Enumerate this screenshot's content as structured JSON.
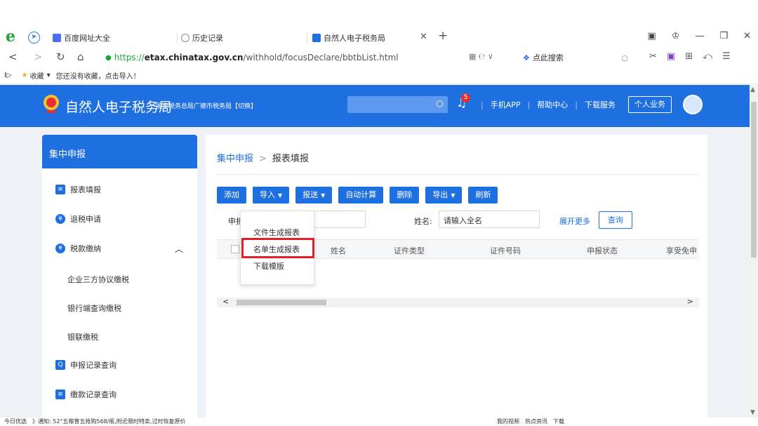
{
  "browser": {
    "tabs": [
      {
        "label": "百度网址大全"
      },
      {
        "label": "历史记录"
      },
      {
        "label": "自然人电子税务局"
      }
    ],
    "url": {
      "protocol": "https://",
      "host": "etax.chinatax.gov.cn",
      "path": "/withhold/focusDeclare/bbtbList.html"
    },
    "search_label": "点此搜索",
    "bookmarks": {
      "label": "收藏",
      "hint": "您还没有收藏，点击导入！"
    }
  },
  "header": {
    "title": "自然人电子税务局",
    "subtitle": "国家税务总局广德市税务局【切换】",
    "notification_count": "5",
    "links": [
      "手机APP",
      "帮助中心",
      "下载服务"
    ],
    "personal_button": "个人业务"
  },
  "sidebar": {
    "title": "集中申报",
    "items": [
      {
        "label": "报表填报"
      },
      {
        "label": "退税申请"
      },
      {
        "label": "税款缴纳"
      },
      {
        "label": "申报记录查询"
      },
      {
        "label": "缴款记录查询"
      }
    ],
    "sub_items": [
      {
        "label": "企业三方协议缴税"
      },
      {
        "label": "银行端查询缴税"
      },
      {
        "label": "银联缴税"
      }
    ]
  },
  "main": {
    "breadcrumb": {
      "parent": "集中申报",
      "current": "报表填报"
    },
    "toolbar": [
      "添加",
      "导入",
      "报送",
      "自动计算",
      "删除",
      "导出",
      "刷新"
    ],
    "filters": {
      "period_label": "申报",
      "name_label": "姓名:",
      "name_placeholder": "请输入全名",
      "expand_label": "展开更多",
      "query_label": "查询"
    },
    "table_headers": [
      "姓名",
      "证件类型",
      "证件号码",
      "申报状态",
      "享受免申"
    ]
  },
  "import_dropdown": {
    "items": [
      "文件生成报表",
      "名单生成报表",
      "下载模版"
    ],
    "highlighted": "名单生成报表"
  },
  "statusbar": {
    "left": "今日优选　》通知: 52°五粮普五抢购568/瓶,附近限时特卖,过时恢复原价",
    "right": "我的视频　热点资讯　下载"
  }
}
